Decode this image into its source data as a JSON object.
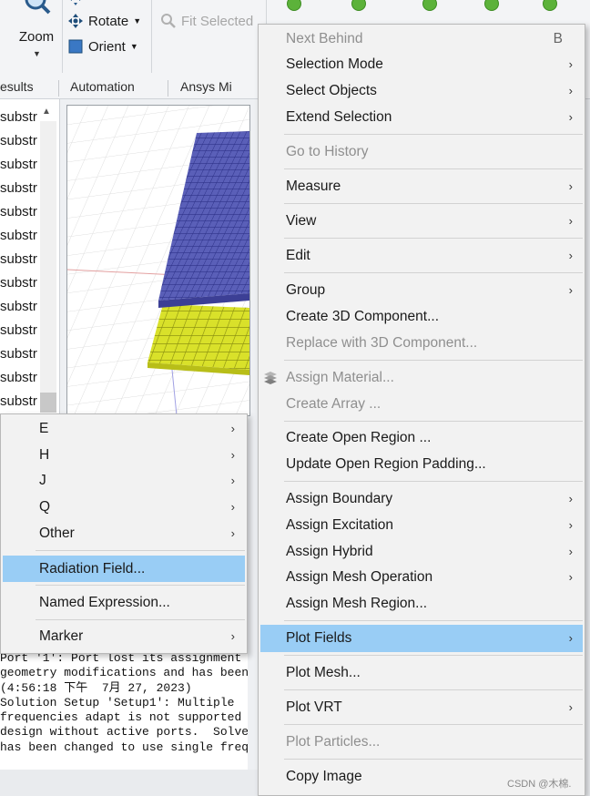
{
  "ribbon": {
    "zoom_label": "Zoom",
    "rotate_label": "Rotate",
    "orient_label": "Orient",
    "fit_selected_label": "Fit Selected"
  },
  "tabs": [
    {
      "label": "esults"
    },
    {
      "label": "Automation"
    },
    {
      "label": "Ansys Mi"
    }
  ],
  "tree": {
    "items": [
      "substr",
      "substr",
      "substr",
      "substr",
      "substr",
      "substr",
      "substr",
      "substr",
      "substr",
      "substr",
      "substr",
      "substr",
      "substr"
    ]
  },
  "context_menu": {
    "items": [
      {
        "label": "Next Behind",
        "shortcut": "B",
        "disabled": true
      },
      {
        "label": "Selection Mode",
        "submenu": true
      },
      {
        "label": "Select Objects",
        "submenu": true
      },
      {
        "label": "Extend Selection",
        "submenu": true
      },
      {
        "label": "Go to History",
        "disabled": true
      },
      {
        "label": "Measure",
        "submenu": true
      },
      {
        "label": "View",
        "submenu": true
      },
      {
        "label": "Edit",
        "submenu": true
      },
      {
        "label": "Group",
        "submenu": true
      },
      {
        "label": "Create 3D Component..."
      },
      {
        "label": "Replace with 3D Component...",
        "disabled": true
      },
      {
        "label": "Assign Material...",
        "disabled": true
      },
      {
        "label": "Create Array ...",
        "disabled": true
      },
      {
        "label": "Create Open Region ..."
      },
      {
        "label": "Update Open Region Padding..."
      },
      {
        "label": "Assign Boundary",
        "submenu": true
      },
      {
        "label": "Assign Excitation",
        "submenu": true
      },
      {
        "label": "Assign Hybrid",
        "submenu": true
      },
      {
        "label": "Assign Mesh Operation",
        "submenu": true
      },
      {
        "label": "Assign Mesh Region..."
      },
      {
        "label": "Plot Fields",
        "submenu": true,
        "highlighted": true
      },
      {
        "label": "Plot Mesh..."
      },
      {
        "label": "Plot VRT",
        "submenu": true
      },
      {
        "label": "Plot Particles...",
        "disabled": true
      },
      {
        "label": "Copy Image"
      }
    ]
  },
  "submenu": {
    "items": [
      {
        "label": "E",
        "submenu": true
      },
      {
        "label": "H",
        "submenu": true
      },
      {
        "label": "J",
        "submenu": true
      },
      {
        "label": "Q",
        "submenu": true
      },
      {
        "label": "Other",
        "submenu": true
      },
      {
        "label": "Radiation Field...",
        "highlighted": true
      },
      {
        "label": "Named Expression..."
      },
      {
        "label": "Marker",
        "submenu": true
      }
    ]
  },
  "console": {
    "lines": [
      "Port '1': Port lost its assignment",
      "geometry modifications and has been",
      "(4:56:18 下午  7月 27, 2023)",
      "Solution Setup 'Setup1': Multiple",
      "frequencies adapt is not supported",
      "design without active ports.  Solve",
      "has been changed to use single freq"
    ]
  },
  "watermark": "CSDN @木棉.",
  "colors": {
    "highlight": "#99cdf5",
    "menu_bg": "#f2f2f2",
    "disabled_text": "#8f8f8f",
    "mesh_blue": "#5a5fb8",
    "mesh_yellow": "#d9e12a"
  },
  "icons": {
    "arrow": "›"
  }
}
